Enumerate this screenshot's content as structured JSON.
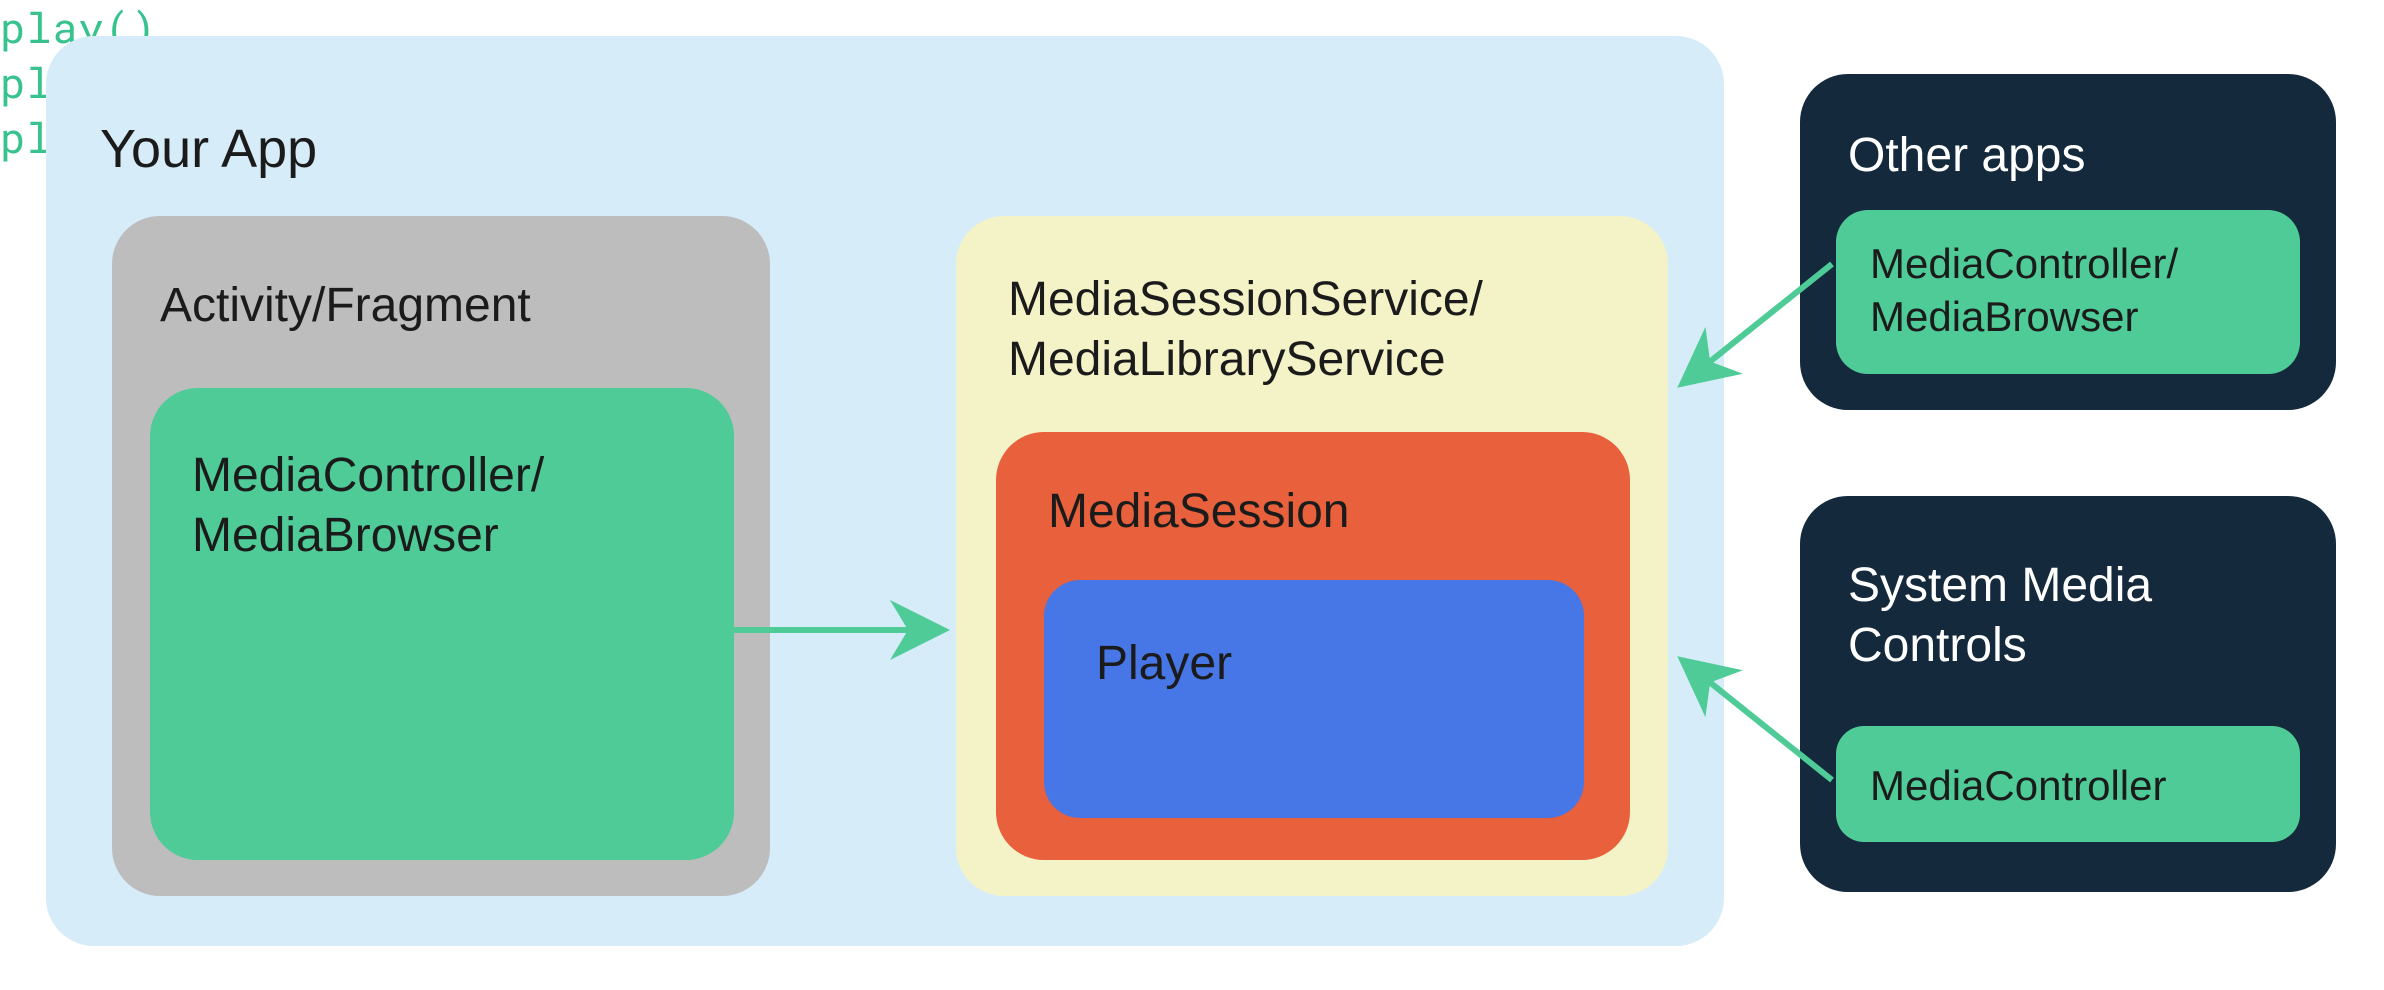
{
  "your_app": {
    "title": "Your App",
    "activity_fragment": {
      "title": "Activity/Fragment",
      "controller_label": "MediaController/\nMediaBrowser"
    },
    "service": {
      "title": "MediaSessionService/\nMediaLibraryService",
      "session_label": "MediaSession",
      "player_label": "Player"
    }
  },
  "other_apps": {
    "title": "Other apps",
    "controller_label": "MediaController/\nMediaBrowser"
  },
  "system_media_controls": {
    "title": "System Media\nControls",
    "controller_label": "MediaController"
  },
  "arrow_labels": {
    "internal_play": "play()",
    "other_apps_play": "play()",
    "system_play": "play()"
  },
  "colors": {
    "app_bg": "#d6ecf8",
    "activity_bg": "#bdbdbd",
    "controller_green": "#4ecb97",
    "service_bg": "#f4f3c8",
    "session_bg": "#e8613c",
    "player_bg": "#4776e6",
    "external_bg": "#14293b",
    "arrow_green": "#4ecb97"
  }
}
